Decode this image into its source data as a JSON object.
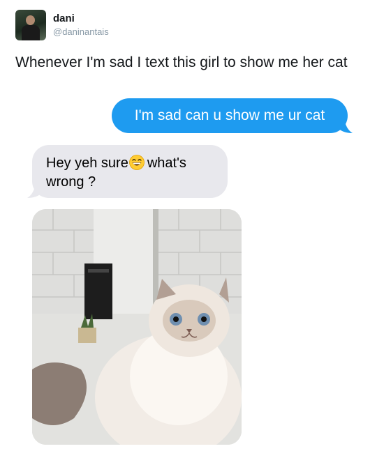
{
  "tweet": {
    "display_name": "dani",
    "handle": "@daninantais",
    "text": "Whenever I'm sad I text this girl to show me her cat"
  },
  "messages": {
    "sent": "I'm sad can u show me ur cat",
    "received_part1": "Hey yeh sure",
    "received_emoji": "grinning-face-emoji",
    "received_part2": "what's wrong ?"
  },
  "colors": {
    "sent_bubble": "#1e9bf0",
    "received_bubble": "#e8e8ed",
    "handle_gray": "#8899a6"
  }
}
